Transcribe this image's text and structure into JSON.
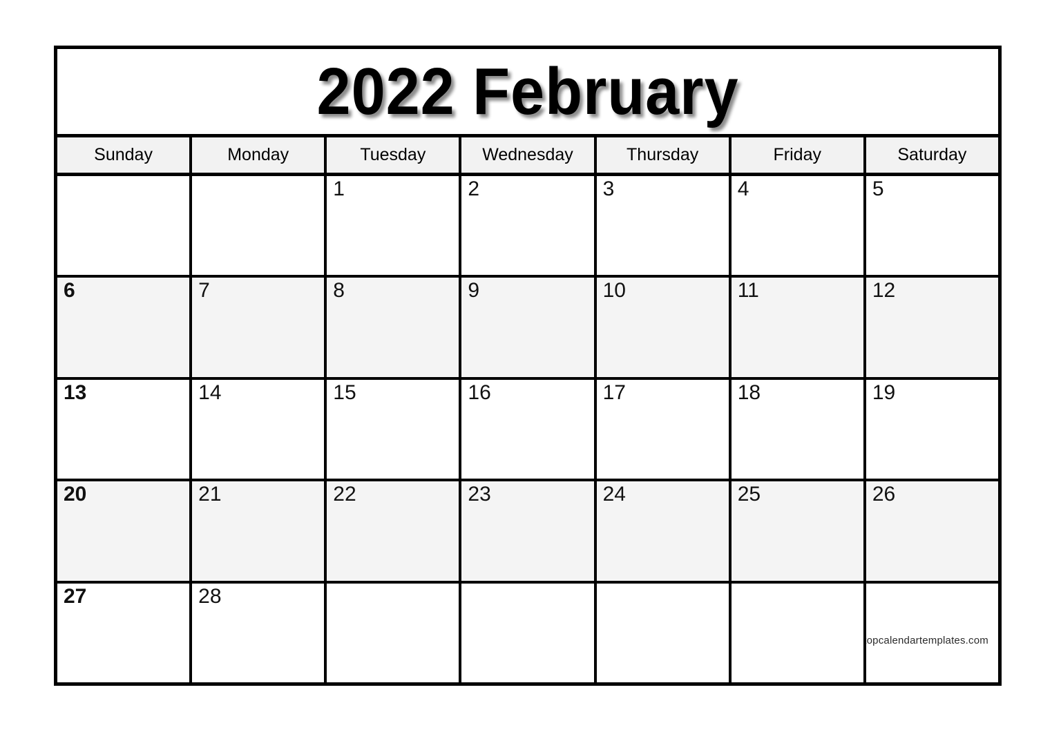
{
  "calendar": {
    "title": "2022 February",
    "year": "2022",
    "month": "February",
    "weekday_headers": [
      "Sunday",
      "Monday",
      "Tuesday",
      "Wednesday",
      "Thursday",
      "Friday",
      "Saturday"
    ],
    "weeks": [
      {
        "shaded": false,
        "days": [
          "",
          "",
          "1",
          "2",
          "3",
          "4",
          "5"
        ]
      },
      {
        "shaded": true,
        "days": [
          "6",
          "7",
          "8",
          "9",
          "10",
          "11",
          "12"
        ]
      },
      {
        "shaded": false,
        "days": [
          "13",
          "14",
          "15",
          "16",
          "17",
          "18",
          "19"
        ]
      },
      {
        "shaded": true,
        "days": [
          "20",
          "21",
          "22",
          "23",
          "24",
          "25",
          "26"
        ]
      },
      {
        "shaded": false,
        "days": [
          "27",
          "28",
          "",
          "",
          "",
          "",
          ""
        ]
      }
    ],
    "watermark": "topcalendartemplates.com",
    "colors": {
      "border": "#000000",
      "header_background": "#f2f2f2",
      "shaded_row_background": "#f4f4f4",
      "page_background": "#ffffff",
      "text": "#000000"
    }
  }
}
